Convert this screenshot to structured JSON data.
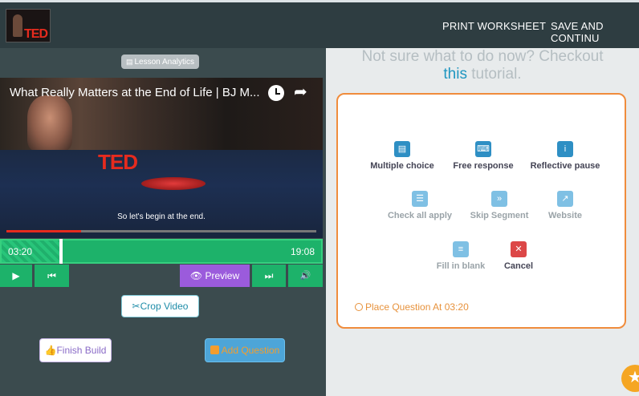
{
  "header": {
    "print_label": "PRINT WORKSHEET",
    "save_label": "SAVE AND CONTINU"
  },
  "left": {
    "analytics_label": "Lesson Analytics",
    "video": {
      "title": "What Really Matters at the End of Life | BJ M...",
      "caption": "So let's begin at the end.",
      "progress": 0.24
    },
    "timeline": {
      "current": "03:20",
      "duration": "19:08",
      "played_fraction": 0.18
    },
    "controls": {
      "play_glyph": "▶",
      "rewind_glyph": "⏮",
      "preview_label": "Preview",
      "forward_glyph": "⏭",
      "volume_glyph": "🔊"
    },
    "crop_label": "Crop Video",
    "finish_label": "Finish Build",
    "add_label": "Add Question"
  },
  "right": {
    "hint_prefix": "Not sure what to do now? Checkout",
    "hint_link": "this",
    "hint_suffix": "tutorial.",
    "types": [
      {
        "label": "Multiple choice",
        "icon": "list-icon"
      },
      {
        "label": "Free response",
        "icon": "keyboard-icon"
      },
      {
        "label": "Reflective pause",
        "icon": "info-icon"
      },
      {
        "label": "Check all apply",
        "icon": "checklist-icon"
      },
      {
        "label": "Skip Segment",
        "icon": "fast-forward-icon"
      },
      {
        "label": "Website",
        "icon": "external-link-icon"
      },
      {
        "label": "Fill in blank",
        "icon": "form-icon"
      },
      {
        "label": "Cancel",
        "icon": "close-icon"
      }
    ],
    "place_label": "Place Question At 03:20"
  },
  "colors": {
    "accent_green": "#1db26a",
    "accent_purple": "#9b5bdc",
    "accent_orange": "#f08c3c",
    "accent_blue": "#2e8fc4"
  }
}
